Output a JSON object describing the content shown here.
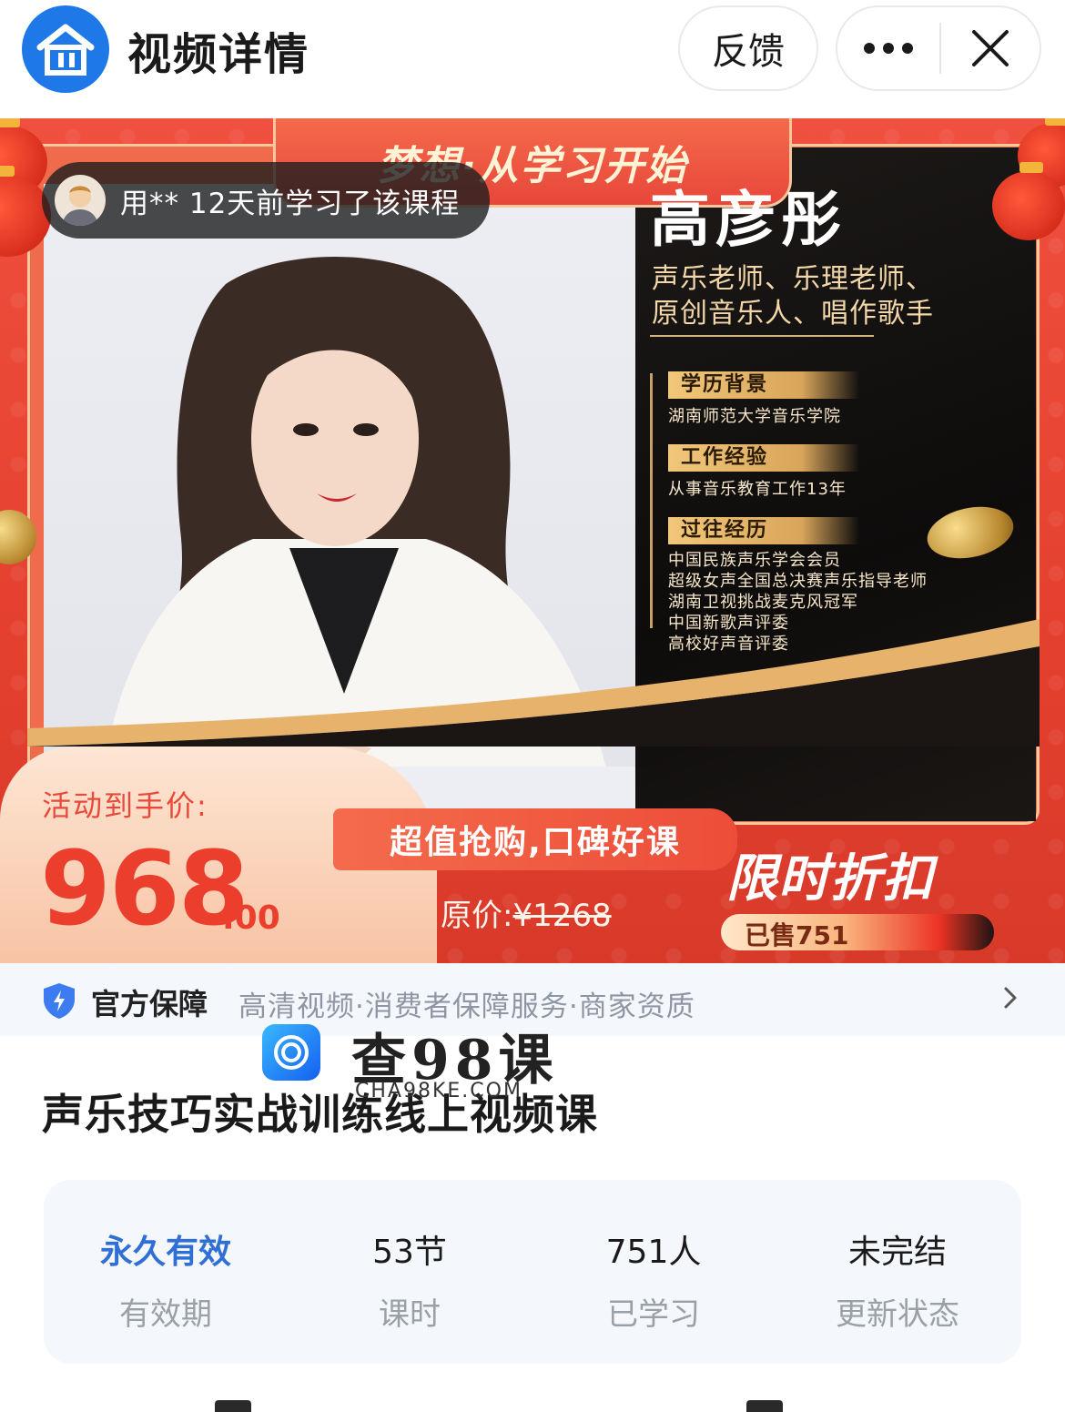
{
  "header": {
    "title": "视频详情",
    "feedback_label": "反馈"
  },
  "banner": {
    "slogan": "梦想·从学习开始",
    "teacher_name": "高彦彤",
    "teacher_roles": [
      "声乐老师、乐理老师、",
      "原创音乐人、唱作歌手"
    ],
    "sections": [
      {
        "tag": "学历背景",
        "items": [
          "湖南师范大学音乐学院"
        ]
      },
      {
        "tag": "工作经验",
        "items": [
          "从事音乐教育工作13年"
        ]
      },
      {
        "tag": "过往经历",
        "items": [
          "中国民族声乐学会会员",
          "超级女声全国总决赛声乐指导老师",
          "湖南卫视挑战麦克风冠军",
          "中国新歌声评委",
          "高校好声音评委"
        ]
      }
    ],
    "learner_notice": "用** 12天前学习了该课程",
    "price_label": "活动到手价:",
    "price_int": "968",
    "price_dec": ".00",
    "promo_text": "超值抢购,口碑好课",
    "original_price_label": "原价:",
    "original_price": "¥1268",
    "flash_title": "限时折扣",
    "sold_text": "已售751"
  },
  "guarantee": {
    "title": "官方保障",
    "detail": "高清视频·消费者保障服务·商家资质"
  },
  "watermark": {
    "title": "查98课",
    "sub": "CHA98KE.COM"
  },
  "course_title": "声乐技巧实战训练线上视频课",
  "stats": [
    {
      "value": "永久有效",
      "label": "有效期"
    },
    {
      "value": "53节",
      "label": "课时"
    },
    {
      "value": "751人",
      "label": "已学习"
    },
    {
      "value": "未完结",
      "label": "更新状态"
    }
  ],
  "colors": {
    "accent_blue": "#2f6fd6",
    "price_red": "#ec3e2c",
    "banner_red": "#e8473a"
  }
}
